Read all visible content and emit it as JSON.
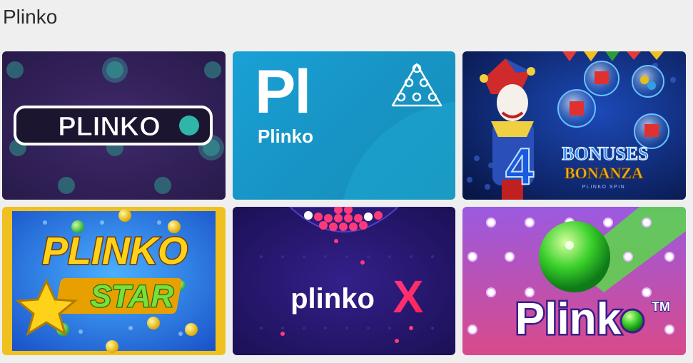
{
  "page": {
    "title": "Plinko"
  },
  "games": [
    {
      "id": "plinko-1",
      "logo_text": "PLINKO"
    },
    {
      "id": "plinko-2",
      "abbr": "Pl",
      "name": "Plinko"
    },
    {
      "id": "bonuses-bonanza",
      "logo_line1": "BONUSES",
      "logo_line2": "BONANZA",
      "logo_sub": "PLINKO SPIN",
      "logo_number": "4"
    },
    {
      "id": "plinko-star",
      "logo_line1": "PLINKO",
      "logo_line2": "STAR"
    },
    {
      "id": "plinko-x",
      "logo_text": "plinko",
      "logo_mark": "X"
    },
    {
      "id": "plinko-tm",
      "logo_text": "Plink",
      "logo_tm": "TM"
    }
  ],
  "colors": {
    "background": "#efefef",
    "tile2": "#1aa1d6",
    "tile3": "#0b1a5c",
    "tile4": "#2b6fd6",
    "tile5": "#2a1670",
    "tile6": "#8b4fd1"
  }
}
